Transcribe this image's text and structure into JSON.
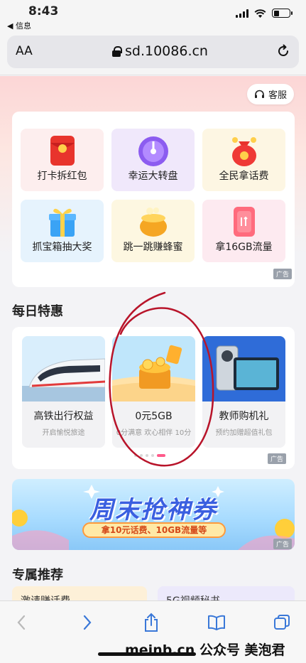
{
  "status_bar": {
    "time": "8:43",
    "back_app": "◀ 信息"
  },
  "address_bar": {
    "text_size_button": "AA",
    "url": "sd.10086.cn"
  },
  "header": {
    "service_label": "客服"
  },
  "promo_grid": {
    "items": [
      {
        "label": "打卡拆红包",
        "icon": "red-envelope-icon",
        "bg": "#fdeeee"
      },
      {
        "label": "幸运大转盘",
        "icon": "lucky-wheel-icon",
        "bg": "#f0e8fb"
      },
      {
        "label": "全民拿话费",
        "icon": "money-bag-icon",
        "bg": "#fdf6e3"
      },
      {
        "label": "抓宝箱抽大奖",
        "icon": "gift-box-icon",
        "bg": "#e6f3fd"
      },
      {
        "label": "跳一跳赚蜂蜜",
        "icon": "honey-pot-icon",
        "bg": "#fdf7e1"
      },
      {
        "label": "拿16GB流量",
        "icon": "data-card-icon",
        "bg": "#fdeaf0"
      }
    ],
    "ad_tag": "广告"
  },
  "daily_deals": {
    "title": "每日特惠",
    "items": [
      {
        "title": "高铁出行权益",
        "subtitle": "开启愉悦旅途",
        "image": "train-image"
      },
      {
        "title": "0元5GB",
        "subtitle": "0分满意 欢心相伴 10分",
        "image": "treasure-chest-image"
      },
      {
        "title": "教师购机礼",
        "subtitle": "预约加赠超值礼包",
        "image": "phone-image"
      }
    ],
    "ad_tag": "广告",
    "carousel": {
      "count": 5,
      "active": 4
    }
  },
  "banner": {
    "title": "周末抢神券",
    "subtitle": "拿10元话费、10GB流量等",
    "ad_tag": "广告"
  },
  "recommend": {
    "title": "专属推荐",
    "items": [
      {
        "label": "激请赚话费"
      },
      {
        "label": "5G视频秘书"
      }
    ]
  },
  "watermark": "meinb.cn 公众号 美泡君",
  "colors": {
    "accent_pink": "#ff5a8a",
    "annotation_red": "#b8142a",
    "link_blue": "#3a78d8"
  }
}
